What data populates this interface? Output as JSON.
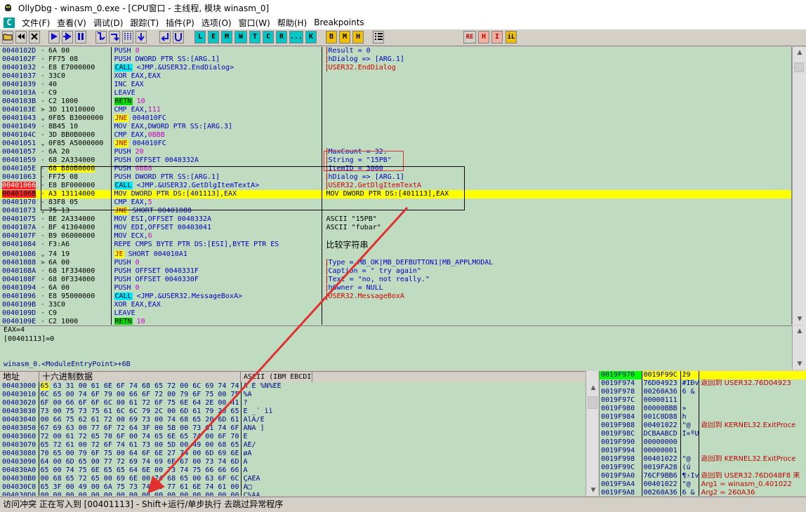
{
  "window": {
    "title": "OllyDbg - winasm_0.exe - [CPU窗口 - 主线程, 模块 winasm_0]"
  },
  "menu": [
    "文件(F)",
    "查看(V)",
    "调试(D)",
    "跟踪(T)",
    "插件(P)",
    "选项(O)",
    "窗口(W)",
    "帮助(H)",
    "Breakpoints"
  ],
  "mdi_icon": "C",
  "toolbar": {
    "letters": [
      "L",
      "E",
      "M",
      "W",
      "T",
      "C",
      "R",
      "...",
      "K",
      "B",
      "M",
      "H"
    ],
    "right_buttons": [
      "RE",
      "H",
      "I",
      "iL"
    ]
  },
  "disasm": [
    {
      "addr": "0040102D",
      "mark": "·",
      "hex": "6A 00",
      "op": "PUSH",
      "arg": " 0",
      "cmt": "Result = 0",
      "cmt_style": "bracket_top"
    },
    {
      "addr": "0040102F",
      "mark": "·",
      "hex": "FF75 08",
      "op": "PUSH",
      "arg": " DWORD PTR SS:[ARG.1]",
      "cmt": "hDialog => [ARG.1]",
      "cmt_style": "bracket"
    },
    {
      "addr": "00401032",
      "mark": "·",
      "hex": "E8 E7000000",
      "op": "CALL",
      "op_style": "hi",
      "arg": " <JMP.&USER32.EndDialog>",
      "cmt": "USER32.EndDialog",
      "cmt_style": "bracket_red"
    },
    {
      "addr": "00401037",
      "mark": "·",
      "hex": "33C0",
      "op": "XOR",
      "arg": " EAX,EAX",
      "cmt": ""
    },
    {
      "addr": "00401039",
      "mark": "·",
      "hex": "40",
      "op": "INC",
      "arg": " EAX",
      "cmt": ""
    },
    {
      "addr": "0040103A",
      "mark": "·",
      "hex": "C9",
      "op": "LEAVE",
      "arg": "",
      "cmt": ""
    },
    {
      "addr": "0040103B",
      "mark": "·",
      "hex": "C2 1000",
      "op": "RETN",
      "op_style": "retn",
      "arg": " 10",
      "cmt": ""
    },
    {
      "addr": "0040103E",
      "mark": ">",
      "hex": "3D 11010000",
      "op": "CMP",
      "arg": " EAX,111",
      "cmt": ""
    },
    {
      "addr": "00401043",
      "mark": "⌄",
      "hex": "0F85 B3000000",
      "op": "JNE",
      "op_style": "jmp",
      "arg": " 004010FC",
      "cmt": ""
    },
    {
      "addr": "00401049",
      "mark": "·",
      "hex": "8B45 10",
      "op": "MOV",
      "arg": " EAX,DWORD PTR SS:[ARG.3]",
      "cmt": ""
    },
    {
      "addr": "0040104C",
      "mark": "·",
      "hex": "3D BB0B0000",
      "op": "CMP",
      "arg": " EAX,0BBB",
      "cmt": ""
    },
    {
      "addr": "00401051",
      "mark": "⌄",
      "hex": "0F85 A5000000",
      "op": "JNE",
      "op_style": "jmp",
      "arg": " 004010FC",
      "cmt": ""
    },
    {
      "addr": "00401057",
      "mark": "·",
      "hex": "6A 20",
      "op": "PUSH",
      "arg": " 20",
      "cmt": "MaxCount = 32.",
      "cmt_style": "bracket_top"
    },
    {
      "addr": "00401059",
      "mark": "·",
      "hex": "68 2A334000",
      "op": "PUSH",
      "arg": " OFFSET 0040332A",
      "cmt": "String = \"15PB\"",
      "cmt_style": "bracket"
    },
    {
      "addr": "0040105E",
      "mark": "·",
      "hex": "68 B80B0000",
      "hex_style": "hi",
      "op": "PUSH",
      "arg": " 0BB8",
      "cmt": "ItemID = 3000",
      "cmt_style": "bracket"
    },
    {
      "addr": "00401063",
      "mark": "·",
      "hex": "FF75 08",
      "op": "PUSH",
      "arg": " DWORD PTR SS:[ARG.1]",
      "cmt": "hDialog => [ARG.1]",
      "cmt_style": "bracket"
    },
    {
      "addr": "00401066",
      "addr_style": "red",
      "mark": "·",
      "hex": "E8 BF000000",
      "op": "CALL",
      "op_style": "hi",
      "arg": " <JMP.&USER32.GetDlgItemTextA>",
      "cmt": "USER32.GetDlgItemTextA",
      "cmt_style": "bracket_red"
    },
    {
      "addr": "0040106B",
      "addr_style": "red2",
      "mark": "·",
      "hex": "A3 13114000",
      "op": "MOV",
      "arg": " DWORD PTR DS:[401113],EAX",
      "cmt": "MOV DWORD PTR DS:[401113],EAX",
      "selected": true
    },
    {
      "addr": "00401070",
      "mark": "·",
      "hex": "83F8 05",
      "op": "CMP",
      "arg": " EAX,5",
      "cmt": ""
    },
    {
      "addr": "00401073",
      "mark": "⌄",
      "hex": "75 13",
      "op": "JNE",
      "op_style": "jmp",
      "arg": " SHORT 00401088",
      "cmt": ""
    },
    {
      "addr": "00401075",
      "mark": "·",
      "hex": "BE 2A334000",
      "op": "MOV",
      "arg": " ESI,OFFSET 0040332A",
      "cmt": "ASCII \"15PB\""
    },
    {
      "addr": "0040107A",
      "mark": "·",
      "hex": "BF 41304000",
      "op": "MOV",
      "arg": " EDI,OFFSET 00403041",
      "cmt": "ASCII \"fubar\""
    },
    {
      "addr": "0040107F",
      "mark": "·",
      "hex": "B9 06000000",
      "op": "MOV",
      "arg": " ECX,6",
      "cmt": ""
    },
    {
      "addr": "00401084",
      "mark": "·",
      "hex": "F3:A6",
      "op": "REPE CMPS",
      "arg": " BYTE PTR DS:[ESI],BYTE PTR ES",
      "cmt": "比较字符串",
      "cmt_style": "chinese"
    },
    {
      "addr": "00401086",
      "mark": "⌄",
      "hex": "74 19",
      "op": "JE",
      "op_style": "jmp",
      "arg": " SHORT 004010A1",
      "cmt": ""
    },
    {
      "addr": "00401088",
      "mark": ">",
      "hex": "6A 00",
      "op": "PUSH",
      "arg": " 0",
      "cmt": "Type = MB_OK|MB_DEFBUTTON1|MB_APPLMODAL",
      "cmt_style": "bracket_top"
    },
    {
      "addr": "0040108A",
      "mark": "·",
      "hex": "68 1F334000",
      "op": "PUSH",
      "arg": " OFFSET 0040331F",
      "cmt": "Caption = \" try again\"",
      "cmt_style": "bracket"
    },
    {
      "addr": "0040108F",
      "mark": "·",
      "hex": "68 0F334000",
      "op": "PUSH",
      "arg": " OFFSET 0040330F",
      "cmt": "Text = \"no, not really.\"",
      "cmt_style": "bracket"
    },
    {
      "addr": "00401094",
      "mark": "·",
      "hex": "6A 00",
      "op": "PUSH",
      "arg": " 0",
      "cmt": "hOwner = NULL",
      "cmt_style": "bracket"
    },
    {
      "addr": "00401096",
      "mark": "·",
      "hex": "E8 95000000",
      "op": "CALL",
      "op_style": "hi",
      "arg": " <JMP.&USER32.MessageBoxA>",
      "cmt": "USER32.MessageBoxA",
      "cmt_style": "bracket_red"
    },
    {
      "addr": "0040109B",
      "mark": "·",
      "hex": "33C0",
      "op": "XOR",
      "arg": " EAX,EAX",
      "cmt": ""
    },
    {
      "addr": "0040109D",
      "mark": "·",
      "hex": "C9",
      "op": "LEAVE",
      "arg": "",
      "cmt": ""
    },
    {
      "addr": "0040109E",
      "mark": "·",
      "hex": "C2 1000",
      "op": "RETN",
      "op_style": "retn",
      "arg": " 10",
      "cmt": ""
    }
  ],
  "info": {
    "line1": "EAX=4",
    "line2": "[00401113]=0",
    "line3": "winasm_0.<ModuleEntryPoint>+6B"
  },
  "dump": {
    "headers": [
      "地址",
      "十六进制数据",
      "ASCII (IBM EBCDIC)"
    ],
    "rows": [
      {
        "addr": "00403000",
        "first": "65",
        "hex": " 63 31 00 61 6E 6F 74 68 65 72 00 6C 69 74 74",
        "ascii": "Ä           É %Ñ%ÈÈ"
      },
      {
        "addr": "00403010",
        "hex": "6C 65 00 74 6F 79 00 66 6F 72 00 79 6F 75 00 75",
        "ascii": "%Á"
      },
      {
        "addr": "00403020",
        "hex": "6F 00 66 6F 6F 6C 00 61 72 6F 75 6E 64 2E 00 41",
        "ascii": "?"
      },
      {
        "addr": "00403030",
        "hex": "73 00 75 73 75 61 6C 6C 79 2C 00 6D 61 79 20 65",
        "ascii": "È               _´ ìì"
      },
      {
        "addr": "00403040",
        "hex": "00 66 75 62 61 72 00 69 73 00 74 68 65 20 6D 61",
        "ascii": "    ÀlÁ/É"
      },
      {
        "addr": "00403050",
        "hex": "67 69 63 00 77 6F 72 64 3F 00 5B 00 73 61 74 6F",
        "ascii": "ÁÑÄ          ]"
      },
      {
        "addr": "00403060",
        "hex": "72 00 61 72 65 70 6F 00 74 65 6E 65 74 00 6F 70",
        "ascii": "Ê"
      },
      {
        "addr": "00403070",
        "hex": "65 72 61 00 72 6F 74 61 73 00 5D 00 49 00 68 65",
        "ascii": "ÁÊ/"
      },
      {
        "addr": "00403080",
        "hex": "70 65 00 79 6F 75 00 64 6F 6E 27 74 00 6D 69 6E",
        "ascii": "øÁ"
      },
      {
        "addr": "00403090",
        "hex": "64 00 6D 65 00 77 72 69 74 69 6E 67 00 73 74 6D",
        "ascii": "À"
      },
      {
        "addr": "004030A0",
        "hex": "65 00 74 75 6E 65 65 64 6E 00 73 74 75 66 66 66",
        "ascii": "Á"
      },
      {
        "addr": "004030B0",
        "hex": "00 68 65 72 65 00 69 6E 00 74 68 65 00 63 6F 6C",
        "ascii": "    ÇÁÊÁ"
      },
      {
        "addr": "004030C0",
        "hex": "65 3F 00 49 00 6A 75 73 74 00 77 61 6E 74 61 00",
        "ascii": "Á□"
      },
      {
        "addr": "004030D0",
        "hex": "00 00 00 00 00 00 00 00 00 00 00 00 00 00 00 00",
        "ascii": "Ç%ÀÁ"
      }
    ]
  },
  "stack": [
    {
      "addr": "0019F970",
      "val": "0019F99C",
      "asc": "ž9",
      "cmt": "",
      "top": true
    },
    {
      "addr": "0019F974",
      "val": "76D04923",
      "asc": "#IÐv",
      "cmt": "返回到 USER32.76D04923"
    },
    {
      "addr": "0019F978",
      "val": "00260A36",
      "asc": "6 &",
      "cmt": ""
    },
    {
      "addr": "0019F97C",
      "val": "00000111",
      "asc": "",
      "cmt": ""
    },
    {
      "addr": "0019F980",
      "val": "00000BBB",
      "asc": "»",
      "cmt": ""
    },
    {
      "addr": "0019F984",
      "val": "001C0D88",
      "asc": "h",
      "cmt": ""
    },
    {
      "addr": "0019F988",
      "val": "00401022",
      "asc": "\"@",
      "cmt": "返回到 KERNEL32.ExitProce"
    },
    {
      "addr": "0019F98C",
      "val": "DCBAABCD",
      "asc": "Í«ºÜ",
      "cmt": ""
    },
    {
      "addr": "0019F990",
      "val": "00000000",
      "asc": "",
      "cmt": ""
    },
    {
      "addr": "0019F994",
      "val": "00000001",
      "asc": "",
      "cmt": ""
    },
    {
      "addr": "0019F998",
      "val": "00401022",
      "asc": "\"@",
      "cmt": "返回到 KERNEL32.ExitProce"
    },
    {
      "addr": "0019F99C",
      "val": "0019FA28",
      "asc": "(ú",
      "cmt": ""
    },
    {
      "addr": "0019F9A0",
      "val": "76CF9BB6",
      "asc": "¶›Ïv",
      "cmt": "返回到 USER32.76D048F8 来"
    },
    {
      "addr": "0019F9A4",
      "val": "00401022",
      "asc": "\"@",
      "cmt": "Arg1 = winasm_0.401022"
    },
    {
      "addr": "0019F9A8",
      "val": "00260A36",
      "asc": "6 &",
      "cmt": "Arg2 = 260A36"
    }
  ],
  "status": "访问冲突 正在写入到 [00401113] - Shift+运行/单步执行 去跳过异常程序",
  "colors": {
    "pane_bg": "#c0dcc0",
    "selection": "#ffff00",
    "breakpoint": "#ff2020",
    "annotation": "#e03030"
  },
  "icons": [
    "ollydbg-bug-icon",
    "open-icon",
    "restart-icon",
    "close-icon",
    "run-icon",
    "step-icon",
    "pause-icon",
    "step-into-icon",
    "step-over-icon",
    "trace-into-icon",
    "trace-over-icon",
    "execute-till-return-icon",
    "go-to-user-icon",
    "list-icon"
  ]
}
